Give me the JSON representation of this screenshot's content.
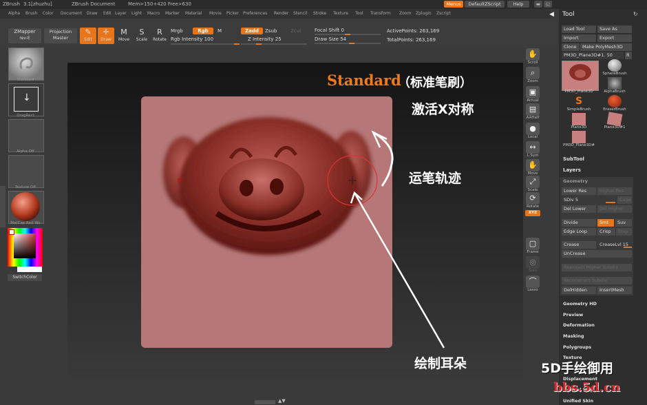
{
  "titlebar": {
    "app": "ZBrush",
    "version": "3.1[zhuzhu]",
    "document": "ZBrush Document",
    "mem": "Mem>150+420 Free>630",
    "menus_btn": "Menus",
    "script_btn": "DefaultZScript",
    "help_btn": "Help"
  },
  "menus": [
    "Alpha",
    "Brush",
    "Color",
    "Document",
    "Draw",
    "Edit",
    "Layer",
    "Light",
    "Macro",
    "Marker",
    "Material",
    "Movie",
    "Picker",
    "Preferences",
    "Render",
    "Stencil",
    "Stroke",
    "Texture",
    "Tool",
    "Transform",
    "Zoom",
    "Zplugin",
    "Zscript"
  ],
  "toolbar": {
    "zmapper": "ZMapper",
    "zmapper_sub": "rev-E",
    "projection": "Projection",
    "master": "Master",
    "edit": "Edit",
    "draw": "Draw",
    "move": "Move",
    "scale": "Scale",
    "rotate": "Rotate",
    "mrgb": "Mrgb",
    "rgb": "Rgb",
    "m": "M",
    "rgb_intensity": "Rgb Intensity 100",
    "zadd": "Zadd",
    "zsub": "Zsub",
    "zcut": "Zcut",
    "z_intensity": "Z Intensity 25",
    "focal_shift": "Focal Shift 0",
    "draw_size": "Draw Size 54",
    "active_points": "ActivePoints: 263,169",
    "total_points": "TotalPoints: 263,169"
  },
  "left_shelf": {
    "brush": "Standard",
    "stroke": "DragRect",
    "alpha": "Alpha Off",
    "texture": "Texture Off",
    "material": "MatCap Red Wa",
    "switch_color": "SwitchColor"
  },
  "right_shelf": [
    "Scroll",
    "Zoom",
    "Actual",
    "AAHalf",
    "Local",
    "L.Sym",
    "Move",
    "Scale",
    "Rotate",
    "XYZ",
    "Frame",
    "Solo",
    "Lasso"
  ],
  "tool_panel": {
    "title": "Tool",
    "load_tool": "Load Tool",
    "save_as": "Save As",
    "import": "Import",
    "export": "Export",
    "clone": "Clone",
    "make_polymesh": "Make PolyMesh3D",
    "current_tool": "PM3D_Plane3D#1. 50",
    "r": "R",
    "brushes": [
      {
        "label": "PM3D_Plane3D"
      },
      {
        "label": "SphereBrush"
      },
      {
        "label": "AlphaBrush"
      },
      {
        "label": "SimpleBrush"
      },
      {
        "label": "EraserBrush"
      },
      {
        "label": "Plane3D"
      },
      {
        "label": "Plane3D#1"
      },
      {
        "label": "PM3D_Plane3D#"
      }
    ],
    "subtool": "SubTool",
    "layers": "Layers",
    "geometry": "Geometry",
    "lower_res": "Lower Res",
    "higher_res": "Higher Res",
    "sdiv": "SDiv 5",
    "cage": "Cage",
    "del_lower": "Del Lower",
    "del_higher": "Del Higher",
    "divide": "Divide",
    "smt": "Smt",
    "suv": "Suv",
    "edge_loop": "Edge Loop",
    "crisp": "Crisp",
    "disp": "Disp",
    "crease": "Crease",
    "crease_lvl": "CreaseLvl 15",
    "uncrease": "UnCrease",
    "reproject": "Reproject Higher Subdiv",
    "reconstruct": "Reconstruct Subdiv",
    "del_hidden": "DelHidden",
    "insert_mesh": "InsertMesh",
    "sections": [
      "Geometry HD",
      "Preview",
      "Deformation",
      "Masking",
      "Polygroups",
      "Texture",
      "Displacement",
      "Normal Map",
      "Unified Skin"
    ]
  },
  "annotations": {
    "title_en": "Standard",
    "title_cn": "（标准笔刷）",
    "symmetry": "激活X对称",
    "stroke_path": "运笔轨迹",
    "draw_ear": "绘制耳朵",
    "watermark1": "5D手绘御用",
    "watermark2": "bbs.5d.cn"
  },
  "colors": {
    "accent": "#e8751a",
    "annotation_orange": "#f07b1c",
    "watermark_red": "#d7262b"
  }
}
